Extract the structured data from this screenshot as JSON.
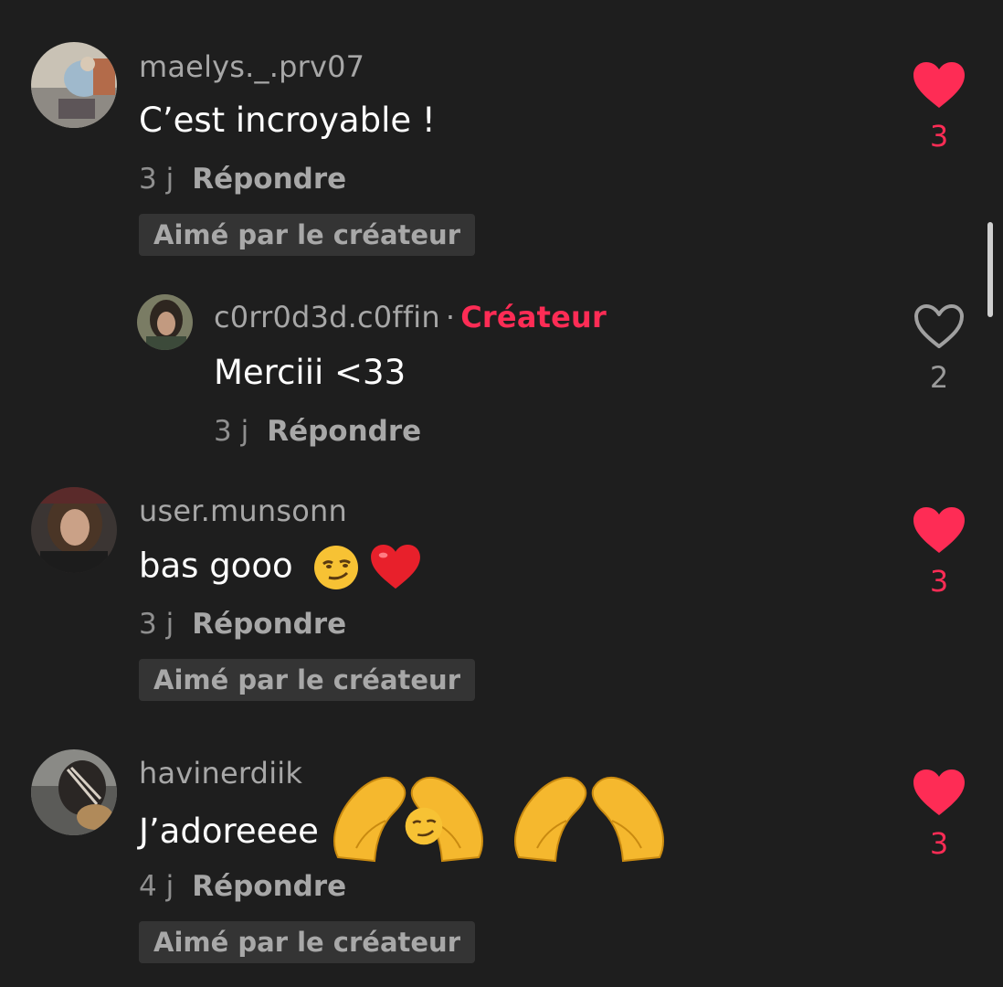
{
  "colors": {
    "background": "#1e1e1e",
    "accent": "#fe2c55",
    "username": "#a7a7a7",
    "meta": "#8f8f8f",
    "badge_bg": "#343434"
  },
  "comments": [
    {
      "username": "maelys._.prv07",
      "text": "C’est incroyable !",
      "time": "3 j",
      "reply_label": "Répondre",
      "badge": "Aimé par le créateur",
      "likes": "3",
      "liked": true
    },
    {
      "username": "c0rr0d3d.c0ffin",
      "creator_label": "Créateur",
      "separator": "·",
      "text": "Merciii <33",
      "time": "3 j",
      "reply_label": "Répondre",
      "likes": "2",
      "liked": false
    },
    {
      "username": "user.munsonn",
      "text": "bas gooo",
      "text_emojis": [
        "smirk-emoji",
        "red-heart-emoji"
      ],
      "time": "3 j",
      "reply_label": "Répondre",
      "badge": "Aimé par le créateur",
      "likes": "3",
      "liked": true
    },
    {
      "username": "havinerdiik",
      "text": "J’adoreeee",
      "text_emojis": [
        "smirk-emoji",
        "heart-hands-emoji",
        "heart-hands-emoji"
      ],
      "time": "4 j",
      "reply_label": "Répondre",
      "badge": "Aimé par le créateur",
      "likes": "3",
      "liked": true
    }
  ]
}
